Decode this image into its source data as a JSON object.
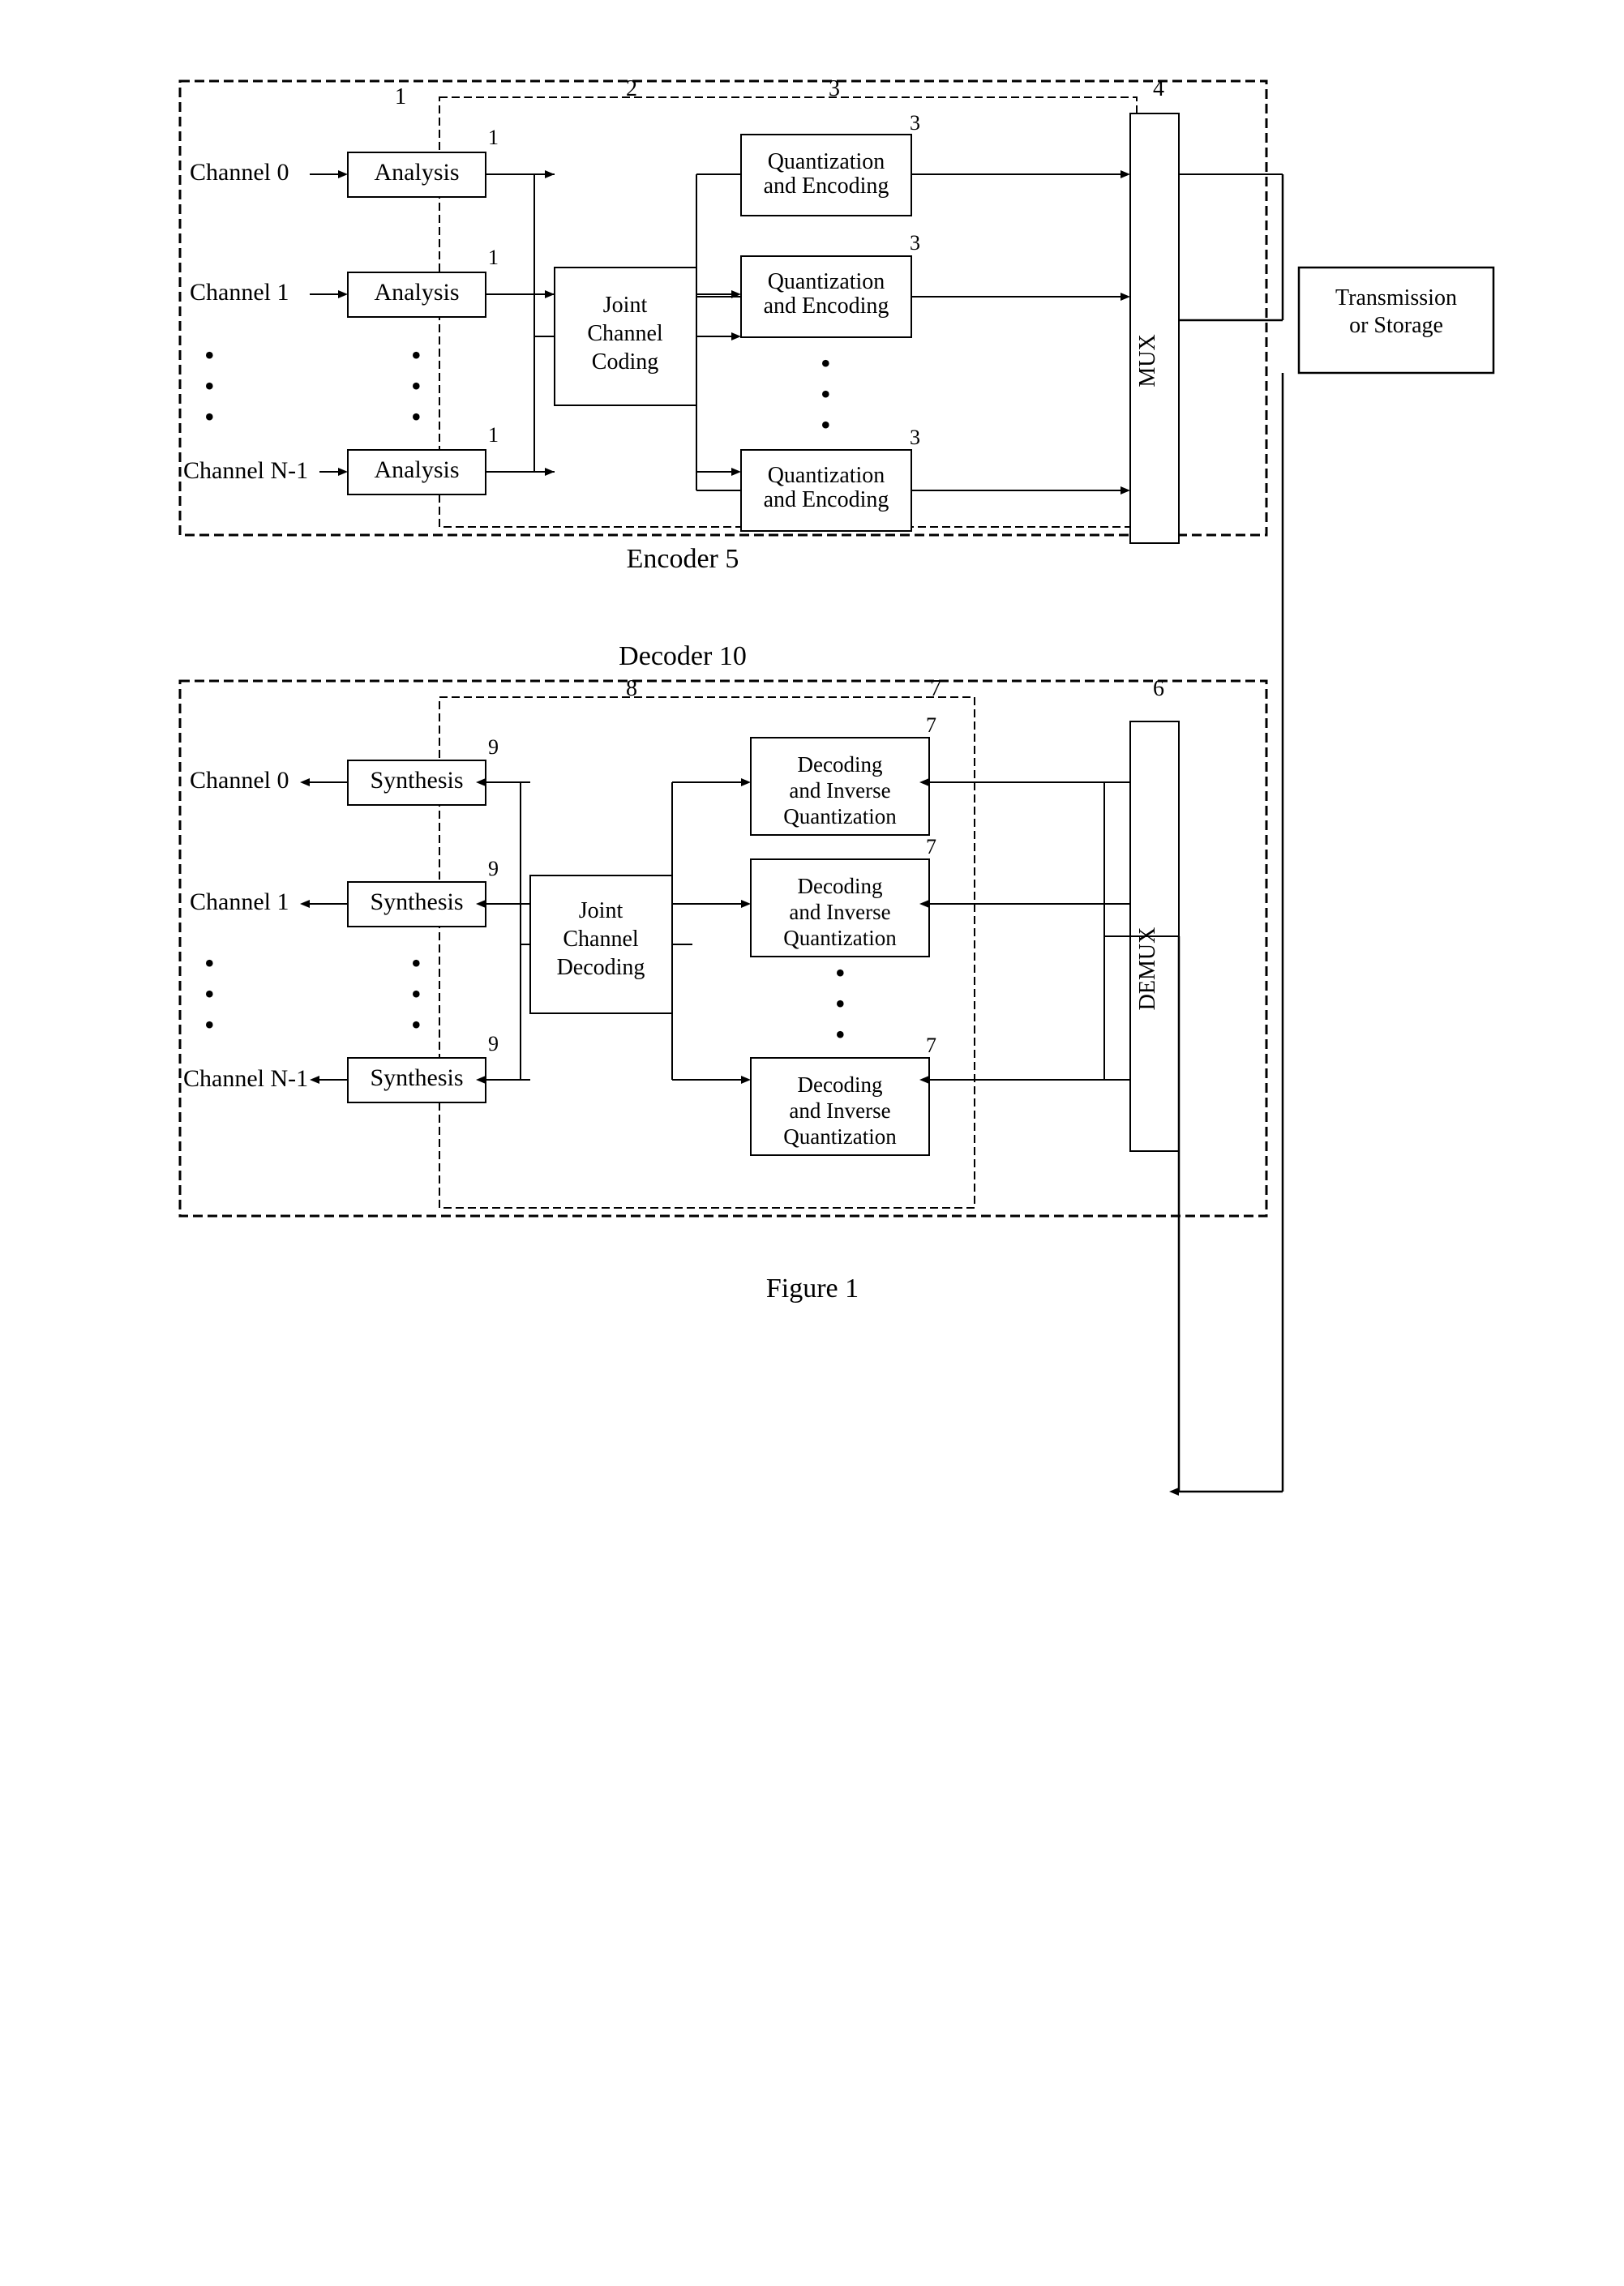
{
  "title": "Figure 1",
  "encoder": {
    "label": "Encoder 5",
    "number": "5",
    "channels": [
      {
        "label": "Channel 0",
        "num": "0"
      },
      {
        "label": "Channel 1",
        "num": "1"
      },
      {
        "label": "Channel N-1",
        "num": "N-1"
      }
    ],
    "analysis_label": "Analysis",
    "joint_coding_label": "Joint\nChannel\nCoding",
    "qe_label": "Quantization\nand\nEncoding",
    "mux_label": "MUX",
    "node_numbers": {
      "n1": "1",
      "n2": "2",
      "n3": "3",
      "n4": "4"
    }
  },
  "transmission": {
    "label": "Transmission\nor Storage"
  },
  "decoder": {
    "label": "Decoder 10",
    "number": "10",
    "channels": [
      {
        "label": "Channel 0"
      },
      {
        "label": "Channel 1"
      },
      {
        "label": "Channel N-1"
      }
    ],
    "synthesis_label": "Synthesis",
    "joint_decoding_label": "Joint\nChannel\nDecoding",
    "diq_label": "Decoding\nand Inverse\nQuantization",
    "demux_label": "DEMUX",
    "node_numbers": {
      "n6": "6",
      "n7": "7",
      "n8": "8",
      "n9": "9"
    }
  },
  "figure_label": "Figure 1"
}
